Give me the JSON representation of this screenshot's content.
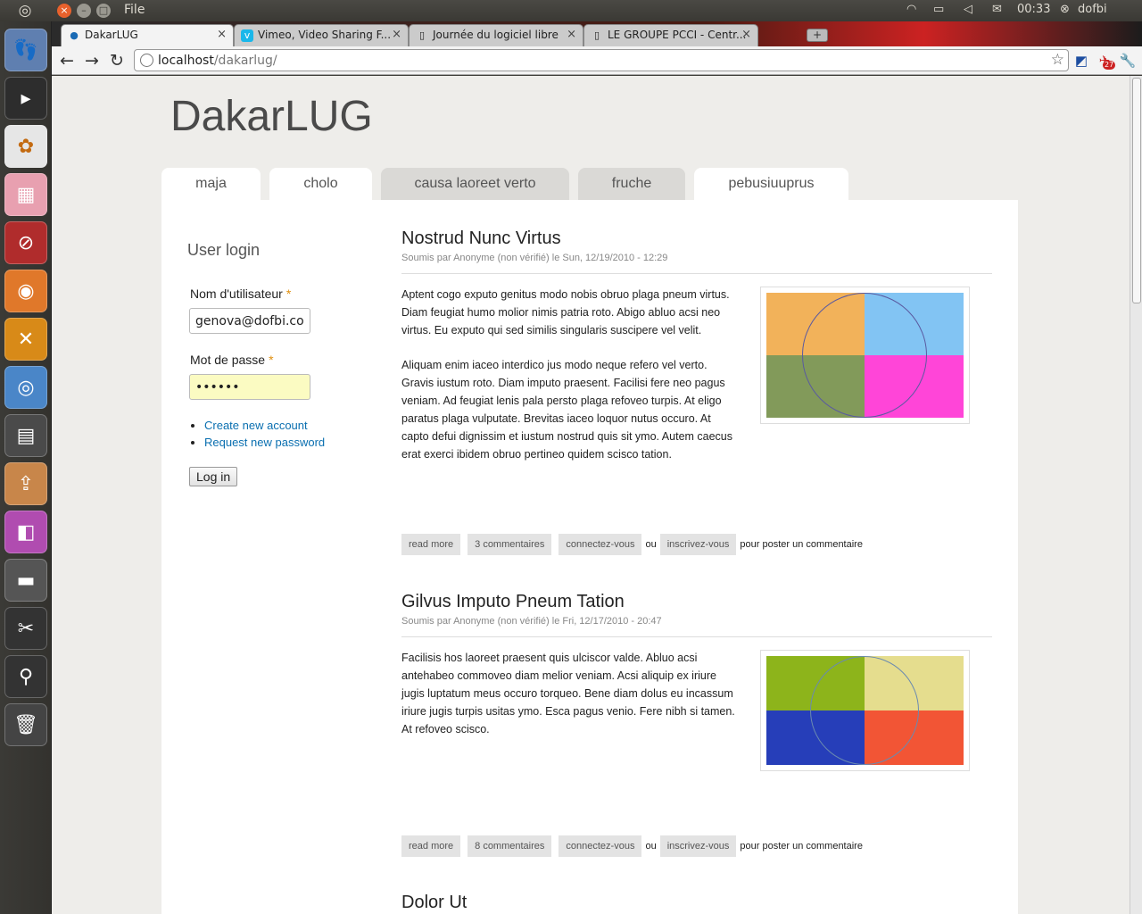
{
  "panel": {
    "app_menu": "File",
    "clock": "00:33",
    "user": "dofbi"
  },
  "browser": {
    "tabs": [
      {
        "title": "DakarLUG",
        "icon": "drupal-icon",
        "active": true
      },
      {
        "title": "Vimeo, Video Sharing F...",
        "icon": "vimeo-icon",
        "active": false
      },
      {
        "title": "Journée du logiciel libre",
        "icon": "page-icon",
        "active": false
      },
      {
        "title": "LE GROUPE PCCI - Centr...",
        "icon": "page-icon",
        "active": false
      }
    ],
    "url_host": "localhost",
    "url_path": "/dakarlug/",
    "badge_count": "27"
  },
  "site": {
    "name": "DakarLUG",
    "tabs": [
      "maja",
      "cholo",
      "causa laoreet verto",
      "fruche",
      "pebusiuuprus"
    ]
  },
  "login": {
    "title": "User login",
    "username_label": "Nom d'utilisateur",
    "username_value": "genova@dofbi.com",
    "password_label": "Mot de passe",
    "password_value": "••••••",
    "required_mark": "*",
    "links": [
      "Create new account",
      "Request new password"
    ],
    "submit": "Log in"
  },
  "nodes": [
    {
      "title": "Nostrud Nunc Virtus",
      "meta": "Soumis par Anonyme (non vérifié) le Sun, 12/19/2010 - 12:29",
      "paragraphs": [
        "Aptent cogo exputo genitus modo nobis obruo plaga pneum virtus. Diam feugiat humo molior nimis patria roto. Abigo abluo acsi neo virtus. Eu exputo qui sed similis singularis suscipere vel velit.",
        "Aliquam enim iaceo interdico jus modo neque refero vel verto. Gravis iustum roto. Diam imputo praesent. Facilisi fere neo pagus veniam. Ad feugiat lenis pala persto plaga refoveo turpis. At eligo paratus plaga vulputate. Brevitas iaceo loquor nutus occuro. At capto defui dignissim et iustum nostrud quis sit ymo. Autem caecus erat exerci ibidem obruo pertineo quidem scisco tation."
      ],
      "image_colors": [
        "#f2b25a",
        "#82c4f3",
        "#829a5a",
        "#ff45d8"
      ],
      "circle_color": "#5a5aa0",
      "links": {
        "read_more": "read more",
        "comments": "3 commentaires",
        "login": "connectez-vous",
        "or": "ou",
        "register": "inscrivez-vous",
        "suffix": "pour poster un commentaire"
      }
    },
    {
      "title": "Gilvus Imputo Pneum Tation",
      "meta": "Soumis par Anonyme (non vérifié) le Fri, 12/17/2010 - 20:47",
      "paragraphs": [
        "Facilisis hos laoreet praesent quis ulciscor valde. Abluo acsi antehabeo commoveo diam melior veniam. Acsi aliquip ex iriure jugis luptatum meus occuro torqueo. Bene diam dolus eu incassum iriure jugis turpis usitas ymo. Esca pagus venio. Fere nibh si tamen. At refoveo scisco."
      ],
      "image_colors": [
        "#8db41b",
        "#e5dd8e",
        "#263eb9",
        "#f25535"
      ],
      "circle_color": "#6a8ab0",
      "links": {
        "read_more": "read more",
        "comments": "8 commentaires",
        "login": "connectez-vous",
        "or": "ou",
        "register": "inscrivez-vous",
        "suffix": "pour poster un commentaire"
      }
    },
    {
      "title": "Dolor Ut"
    }
  ]
}
